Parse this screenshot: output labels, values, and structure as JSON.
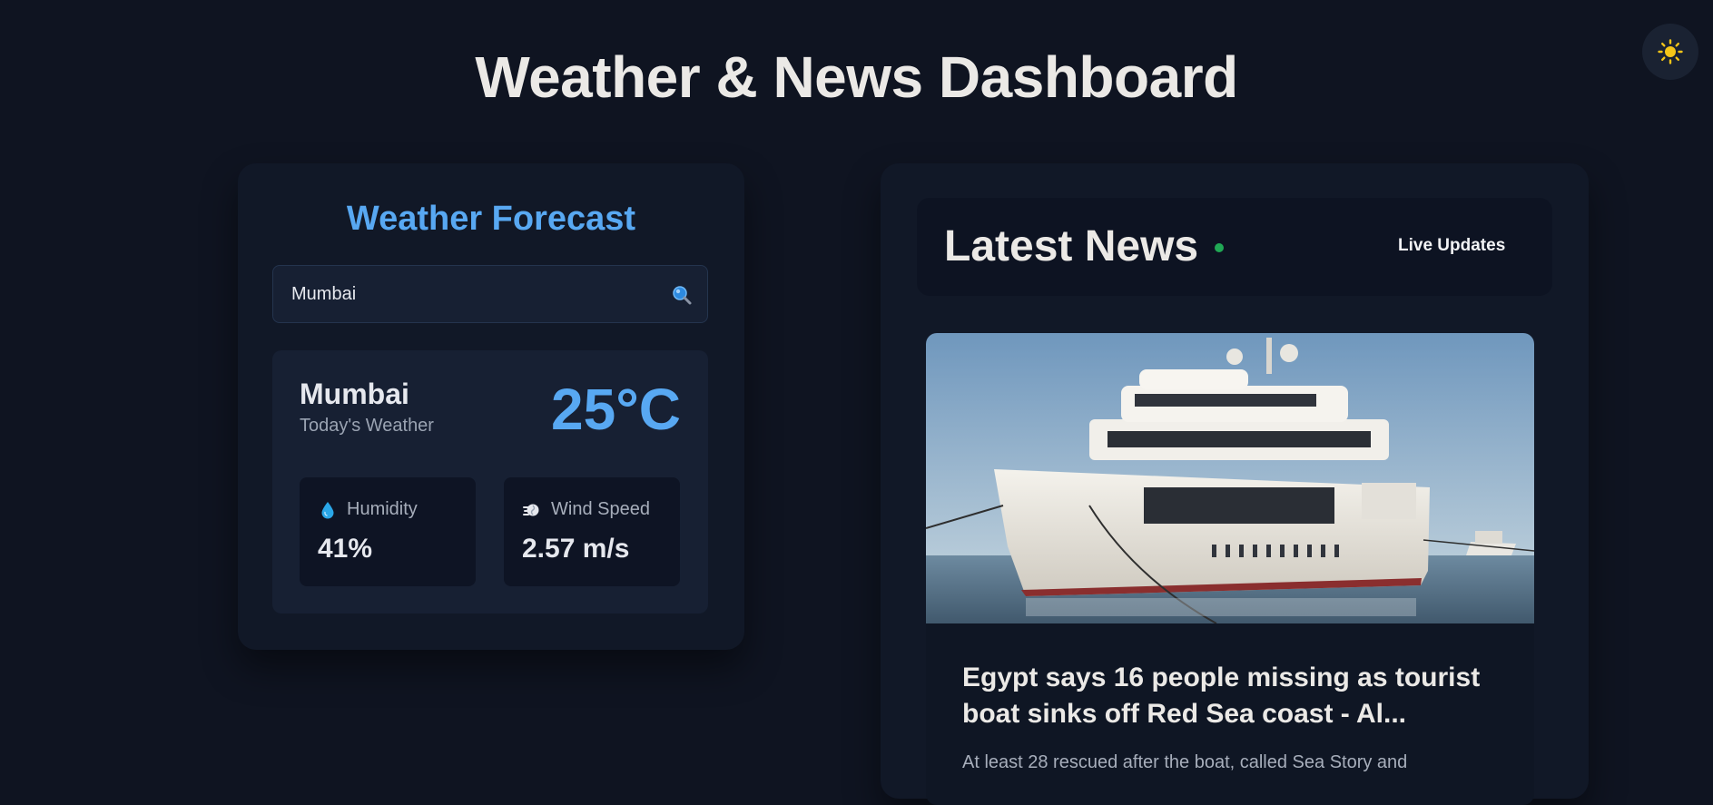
{
  "page_title": "Weather & News Dashboard",
  "theme_toggle": {
    "icon": "sun-icon",
    "color": "#f5c518"
  },
  "weather": {
    "title": "Weather Forecast",
    "search": {
      "value": "Mumbai",
      "icon": "search-icon"
    },
    "city": "Mumbai",
    "subtitle": "Today's Weather",
    "temperature": "25°C",
    "humidity": {
      "label": "Humidity",
      "value": "41%",
      "icon": "droplet-icon"
    },
    "wind": {
      "label": "Wind Speed",
      "value": "2.57 m/s",
      "icon": "wind-icon"
    }
  },
  "news": {
    "title": "Latest News",
    "live_label": "Live Updates",
    "live_dot_color": "#20a855",
    "articles": [
      {
        "image": "cruise-ship-photo",
        "headline": "Egypt says 16 people missing as tourist boat sinks off Red Sea coast - Al...",
        "summary": "At least 28 rescued after the boat, called Sea Story and"
      }
    ]
  },
  "colors": {
    "background": "#0f1421",
    "accent": "#58a8f2",
    "panel": "#111827",
    "card": "#172033"
  }
}
